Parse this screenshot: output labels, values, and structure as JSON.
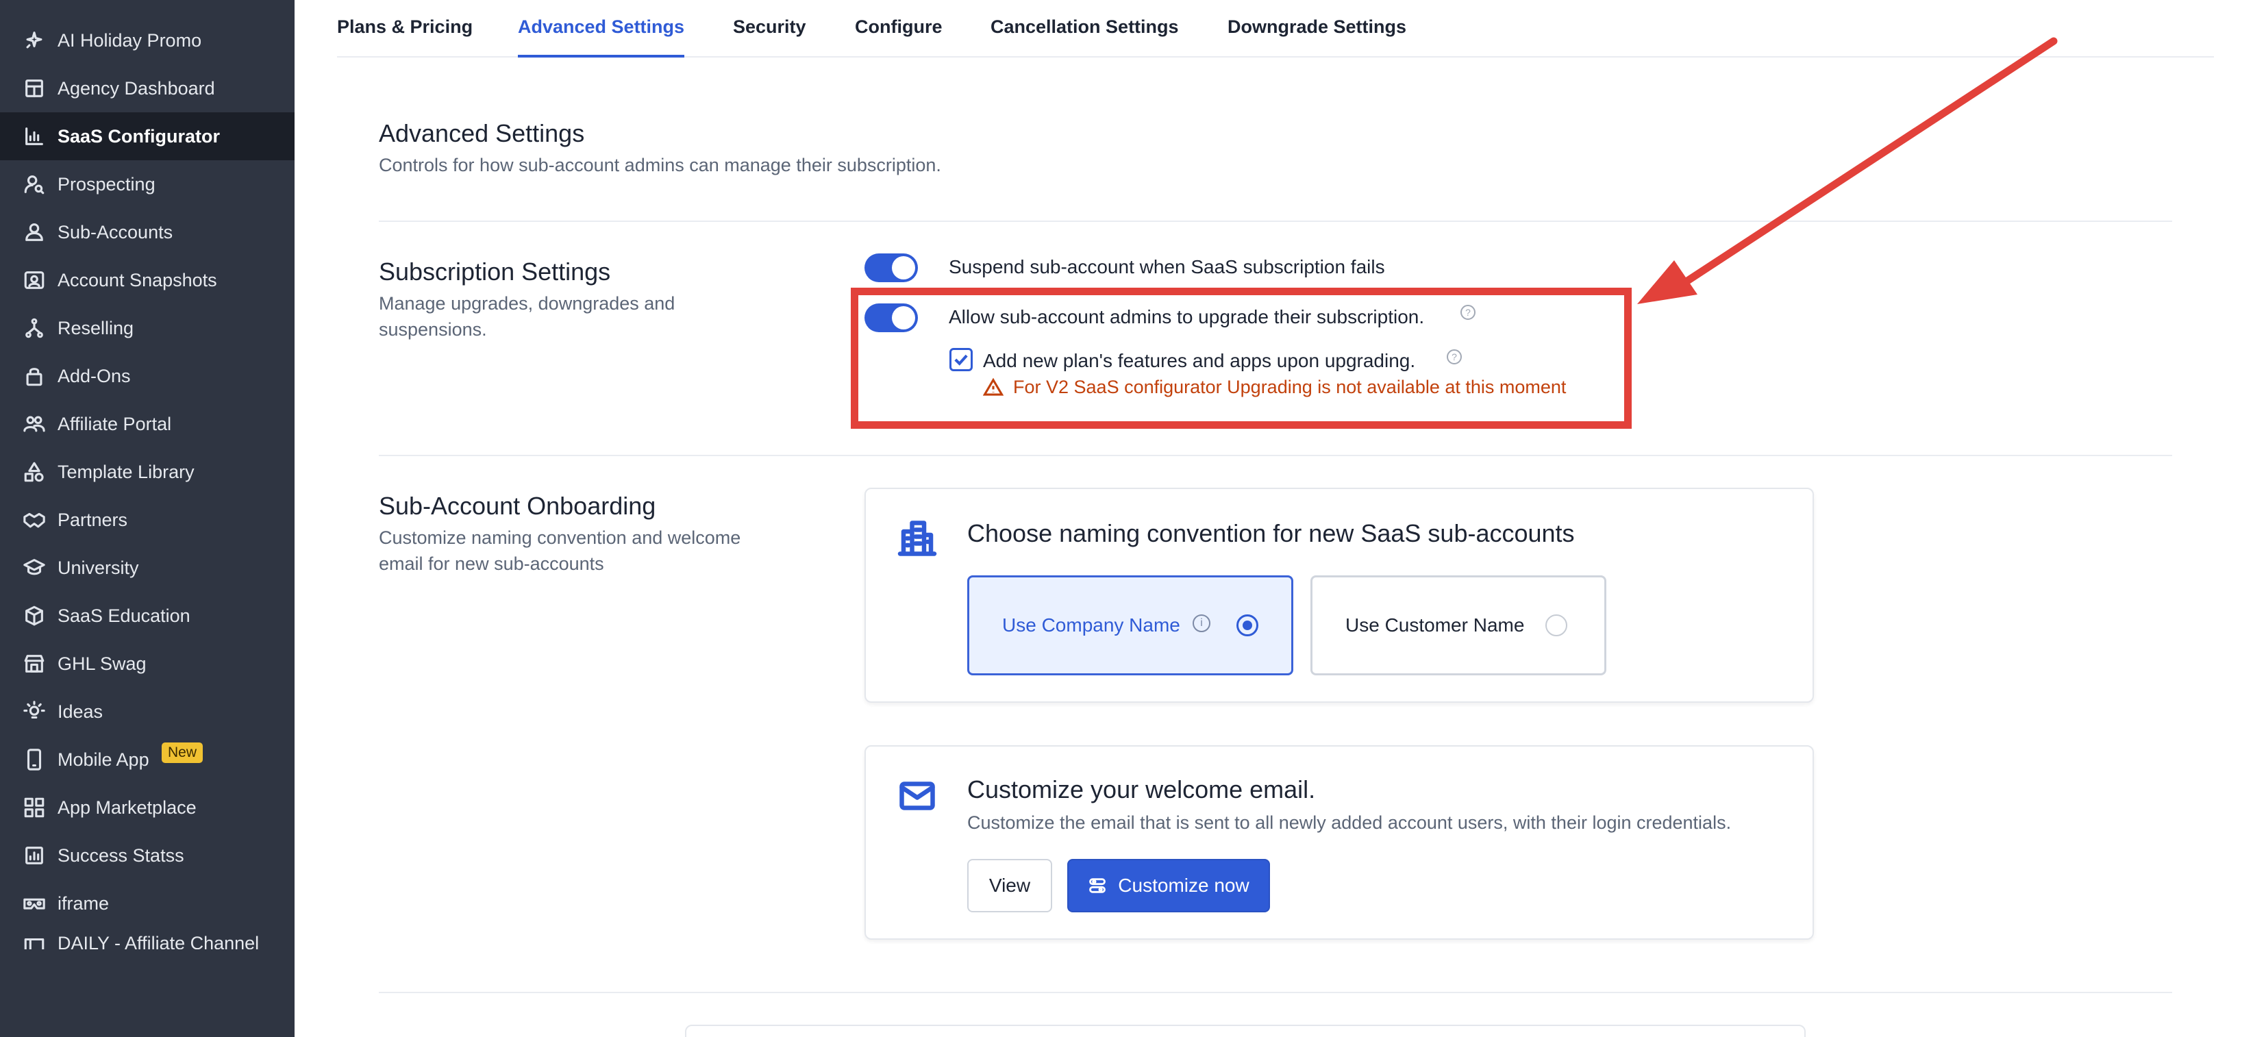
{
  "sidebar": {
    "items": [
      {
        "label": "AI Holiday Promo",
        "icon": "sparkle-icon"
      },
      {
        "label": "Agency Dashboard",
        "icon": "dashboard-icon"
      },
      {
        "label": "SaaS Configurator",
        "icon": "chart-icon",
        "active": true
      },
      {
        "label": "Prospecting",
        "icon": "user-search-icon"
      },
      {
        "label": "Sub-Accounts",
        "icon": "user-icon"
      },
      {
        "label": "Account Snapshots",
        "icon": "snapshot-icon"
      },
      {
        "label": "Reselling",
        "icon": "reselling-icon"
      },
      {
        "label": "Add-Ons",
        "icon": "lock-icon"
      },
      {
        "label": "Affiliate Portal",
        "icon": "users-icon"
      },
      {
        "label": "Template Library",
        "icon": "shapes-icon"
      },
      {
        "label": "Partners",
        "icon": "handshake-icon"
      },
      {
        "label": "University",
        "icon": "graduation-cap-icon"
      },
      {
        "label": "SaaS Education",
        "icon": "cube-icon"
      },
      {
        "label": "GHL Swag",
        "icon": "store-icon"
      },
      {
        "label": "Ideas",
        "icon": "lightbulb-icon"
      },
      {
        "label": "Mobile App",
        "icon": "mobile-icon",
        "badge": "New"
      },
      {
        "label": "App Marketplace",
        "icon": "grid-icon"
      },
      {
        "label": "Success Statss",
        "icon": "stats-icon"
      },
      {
        "label": "iframe",
        "icon": "vr-icon"
      },
      {
        "label": "DAILY - Affiliate Channel",
        "icon": "channel-icon"
      }
    ]
  },
  "tabs": [
    {
      "label": "Plans & Pricing"
    },
    {
      "label": "Advanced Settings",
      "active": true
    },
    {
      "label": "Security"
    },
    {
      "label": "Configure"
    },
    {
      "label": "Cancellation Settings"
    },
    {
      "label": "Downgrade Settings"
    }
  ],
  "advanced": {
    "title": "Advanced Settings",
    "description": "Controls for how sub-account admins can manage their subscription."
  },
  "subscription": {
    "title": "Subscription Settings",
    "description_line1": "Manage upgrades, downgrades and",
    "description_line2": "suspensions.",
    "suspend_label": "Suspend sub-account when SaaS subscription fails",
    "suspend_enabled": true,
    "upgrade_label": "Allow sub-account admins to upgrade their subscription.",
    "upgrade_enabled": true,
    "add_features_label": "Add new plan's features and apps upon upgrading.",
    "add_features_checked": true,
    "warning": "For V2 SaaS configurator Upgrading is not available at this moment"
  },
  "onboarding": {
    "title": "Sub-Account Onboarding",
    "description_line1": "Customize naming convention and welcome",
    "description_line2": "email for new sub-accounts",
    "naming_title": "Choose naming convention for new SaaS sub-accounts",
    "option_company": "Use Company Name",
    "option_customer": "Use Customer Name",
    "selected": "company",
    "email_title": "Customize your welcome email.",
    "email_subtitle": "Customize the email that is sent to all newly added account users, with their login credentials.",
    "view_button": "View",
    "customize_button": "Customize now"
  },
  "colors": {
    "sidebar_bg": "#2f3542",
    "accent": "#2f5bd6",
    "annotation": "#e2413a",
    "warning": "#c2410c"
  }
}
